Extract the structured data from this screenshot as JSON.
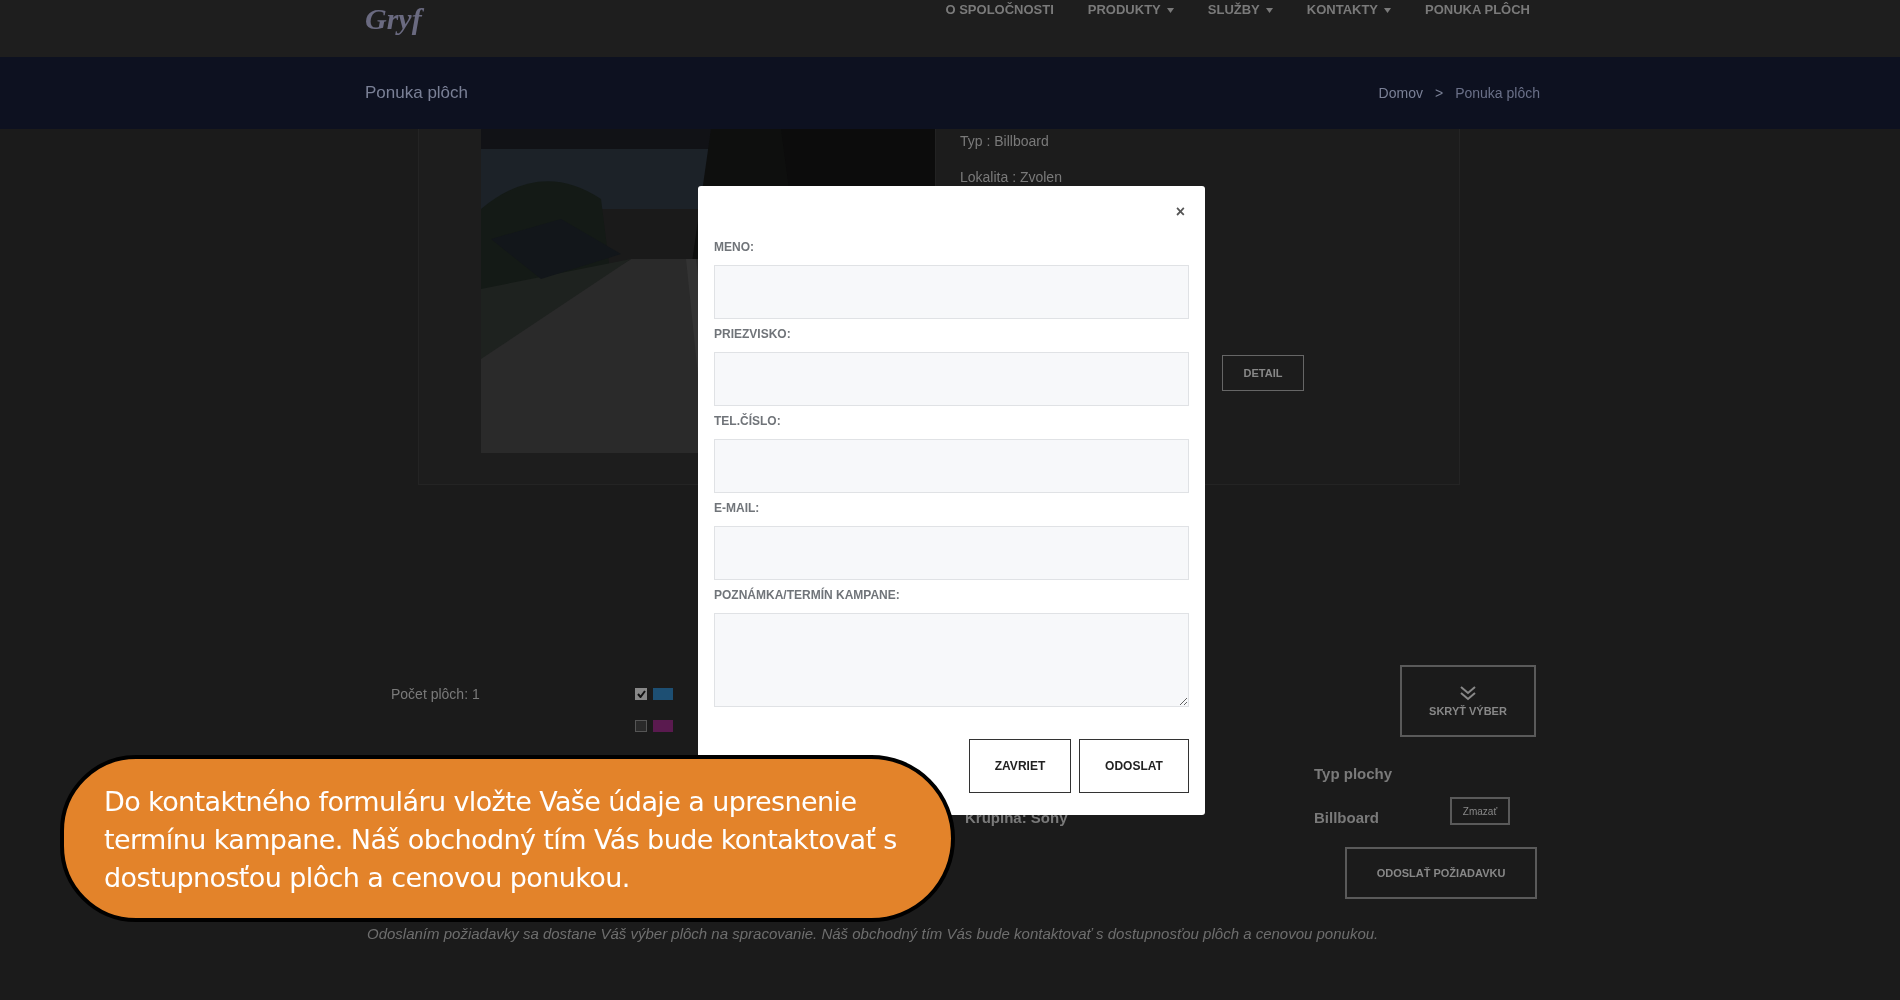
{
  "header": {
    "logo": "Gryf",
    "nav": [
      {
        "label": "O SPOLOČNOSTI",
        "dropdown": false
      },
      {
        "label": "PRODUKTY",
        "dropdown": true
      },
      {
        "label": "SLUŽBY",
        "dropdown": true
      },
      {
        "label": "KONTAKTY",
        "dropdown": true
      },
      {
        "label": "PONUKA PLÔCH",
        "dropdown": false
      }
    ]
  },
  "banner": {
    "title": "Ponuka plôch",
    "breadcrumb": [
      "Domov",
      ">",
      "Ponuka plôch"
    ]
  },
  "listing": {
    "picture": {
      "kind": "picture"
    },
    "details": [
      "Typ : Billboard",
      "Lokalita : Zvolen"
    ],
    "detail_button": "DETAIL"
  },
  "selection": {
    "count": "Počet plôch: 1",
    "legend": [
      {
        "checked": true,
        "color": "#1d4f73"
      },
      {
        "checked": false,
        "color": "#5a1a4f"
      }
    ],
    "hide_button": "SKRYŤ VÝBER",
    "type_heading": "Typ plochy",
    "item_name": "Krupina: Sony",
    "item_type": "Billboard",
    "remove_button": "Zmazať",
    "submit_button": "ODOSLAŤ POŽIADAVKU",
    "note": "Odoslaním požiadavky sa dostane Váš výber plôch na spracovanie. Náš obchodný tím Vás bude kontaktovať s dostupnosťou plôch a cenovou ponukou."
  },
  "modal": {
    "close": "×",
    "fields": [
      {
        "label": "MENO:",
        "kind": "input"
      },
      {
        "label": "PRIEZVISKO:",
        "kind": "input"
      },
      {
        "label": "TEL.ČÍSLO:",
        "kind": "input"
      },
      {
        "label": "E-MAIL:",
        "kind": "input"
      },
      {
        "label": "POZNÁMKA/TERMÍN KAMPANE:",
        "kind": "textarea"
      }
    ],
    "buttons": [
      "ZAVRIET",
      "ODOSLAT"
    ]
  },
  "callout": {
    "text": "Do kontaktného formuláru vložte Vaše údaje a upresnenie termínu kampane. Náš obchodný tím Vás bude kontaktovať s dostupnosťou plôch a cenovou ponukou."
  }
}
